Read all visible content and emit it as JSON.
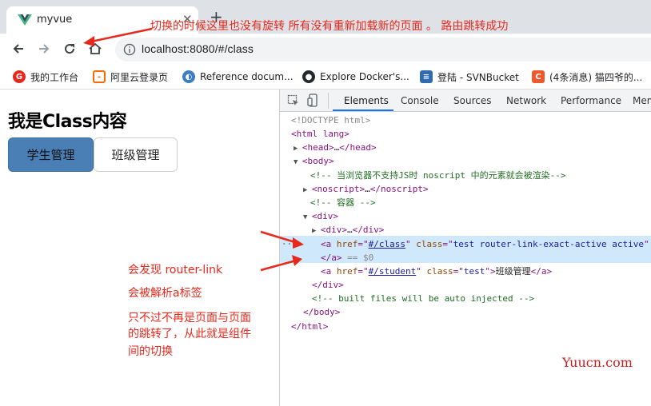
{
  "browser": {
    "tab_title": "myvue",
    "url": "localhost:8080/#/class",
    "bookmarks": [
      {
        "label": "我的工作台",
        "icon": "g-icon"
      },
      {
        "label": "阿里云登录页",
        "icon": "aliyun-icon"
      },
      {
        "label": "Reference docum...",
        "icon": "reference-icon"
      },
      {
        "label": "Explore Docker's...",
        "icon": "github-icon"
      },
      {
        "label": "登陆 - SVNBucket",
        "icon": "svnbucket-icon"
      },
      {
        "label": "(4条消息) 猫四爷的...",
        "icon": "csdn-icon"
      }
    ]
  },
  "page": {
    "heading": "我是Class内容",
    "buttons": [
      "学生管理",
      "班级管理"
    ]
  },
  "devtools": {
    "tabs": [
      "Elements",
      "Console",
      "Sources",
      "Network",
      "Performance",
      "Mem"
    ],
    "active_tab": "Elements",
    "dom": {
      "doctype": "<!DOCTYPE html>",
      "html_open": "<html lang>",
      "head_tag": "head",
      "body_tag": "body",
      "comment_noscript": "<!-- 当浏览器不支持JS时 noscript 中的元素就会被渲染-->",
      "noscript_tag": "noscript",
      "comment_container": "<!-- 容器 -->",
      "div_tag": "div",
      "href_active": "#/class",
      "class_active": "test router-link-exact-active active",
      "dollar_zero": "== $0",
      "href_student": "#/student",
      "class_student": "test",
      "student_text": "班级管理",
      "comment_built": "<!-- built files will be auto injected -->",
      "ellipsis": "…"
    }
  },
  "annotations": {
    "top": "切换的时候这里也没有旋转  所有没有重新加载新的页面 。 路由跳转成功",
    "line1": "会发现 router-link",
    "line2": "会被解析a标签",
    "line3": "只不过不再是页面与页面",
    "line4": "的跳转了，从此就是组件",
    "line5": "间的切换"
  },
  "watermark": "Yuucn.com",
  "colors": {
    "annotation": "#e8281c",
    "active_button": "#4a7fb5",
    "selected_row": "#cfe8fc"
  }
}
